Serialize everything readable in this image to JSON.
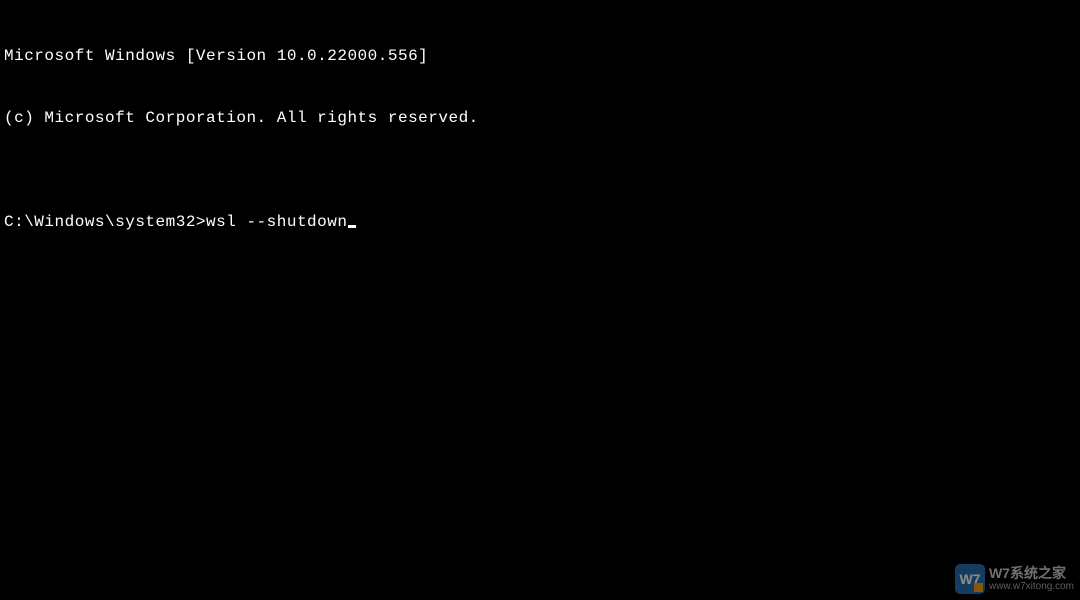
{
  "terminal": {
    "header_line1": "Microsoft Windows [Version 10.0.22000.556]",
    "header_line2": "(c) Microsoft Corporation. All rights reserved.",
    "blank": "",
    "prompt": "C:\\Windows\\system32>",
    "command": "wsl --shutdown"
  },
  "watermark": {
    "logo_text": "W7",
    "title": "W7系统之家",
    "url": "www.w7xitong.com"
  }
}
